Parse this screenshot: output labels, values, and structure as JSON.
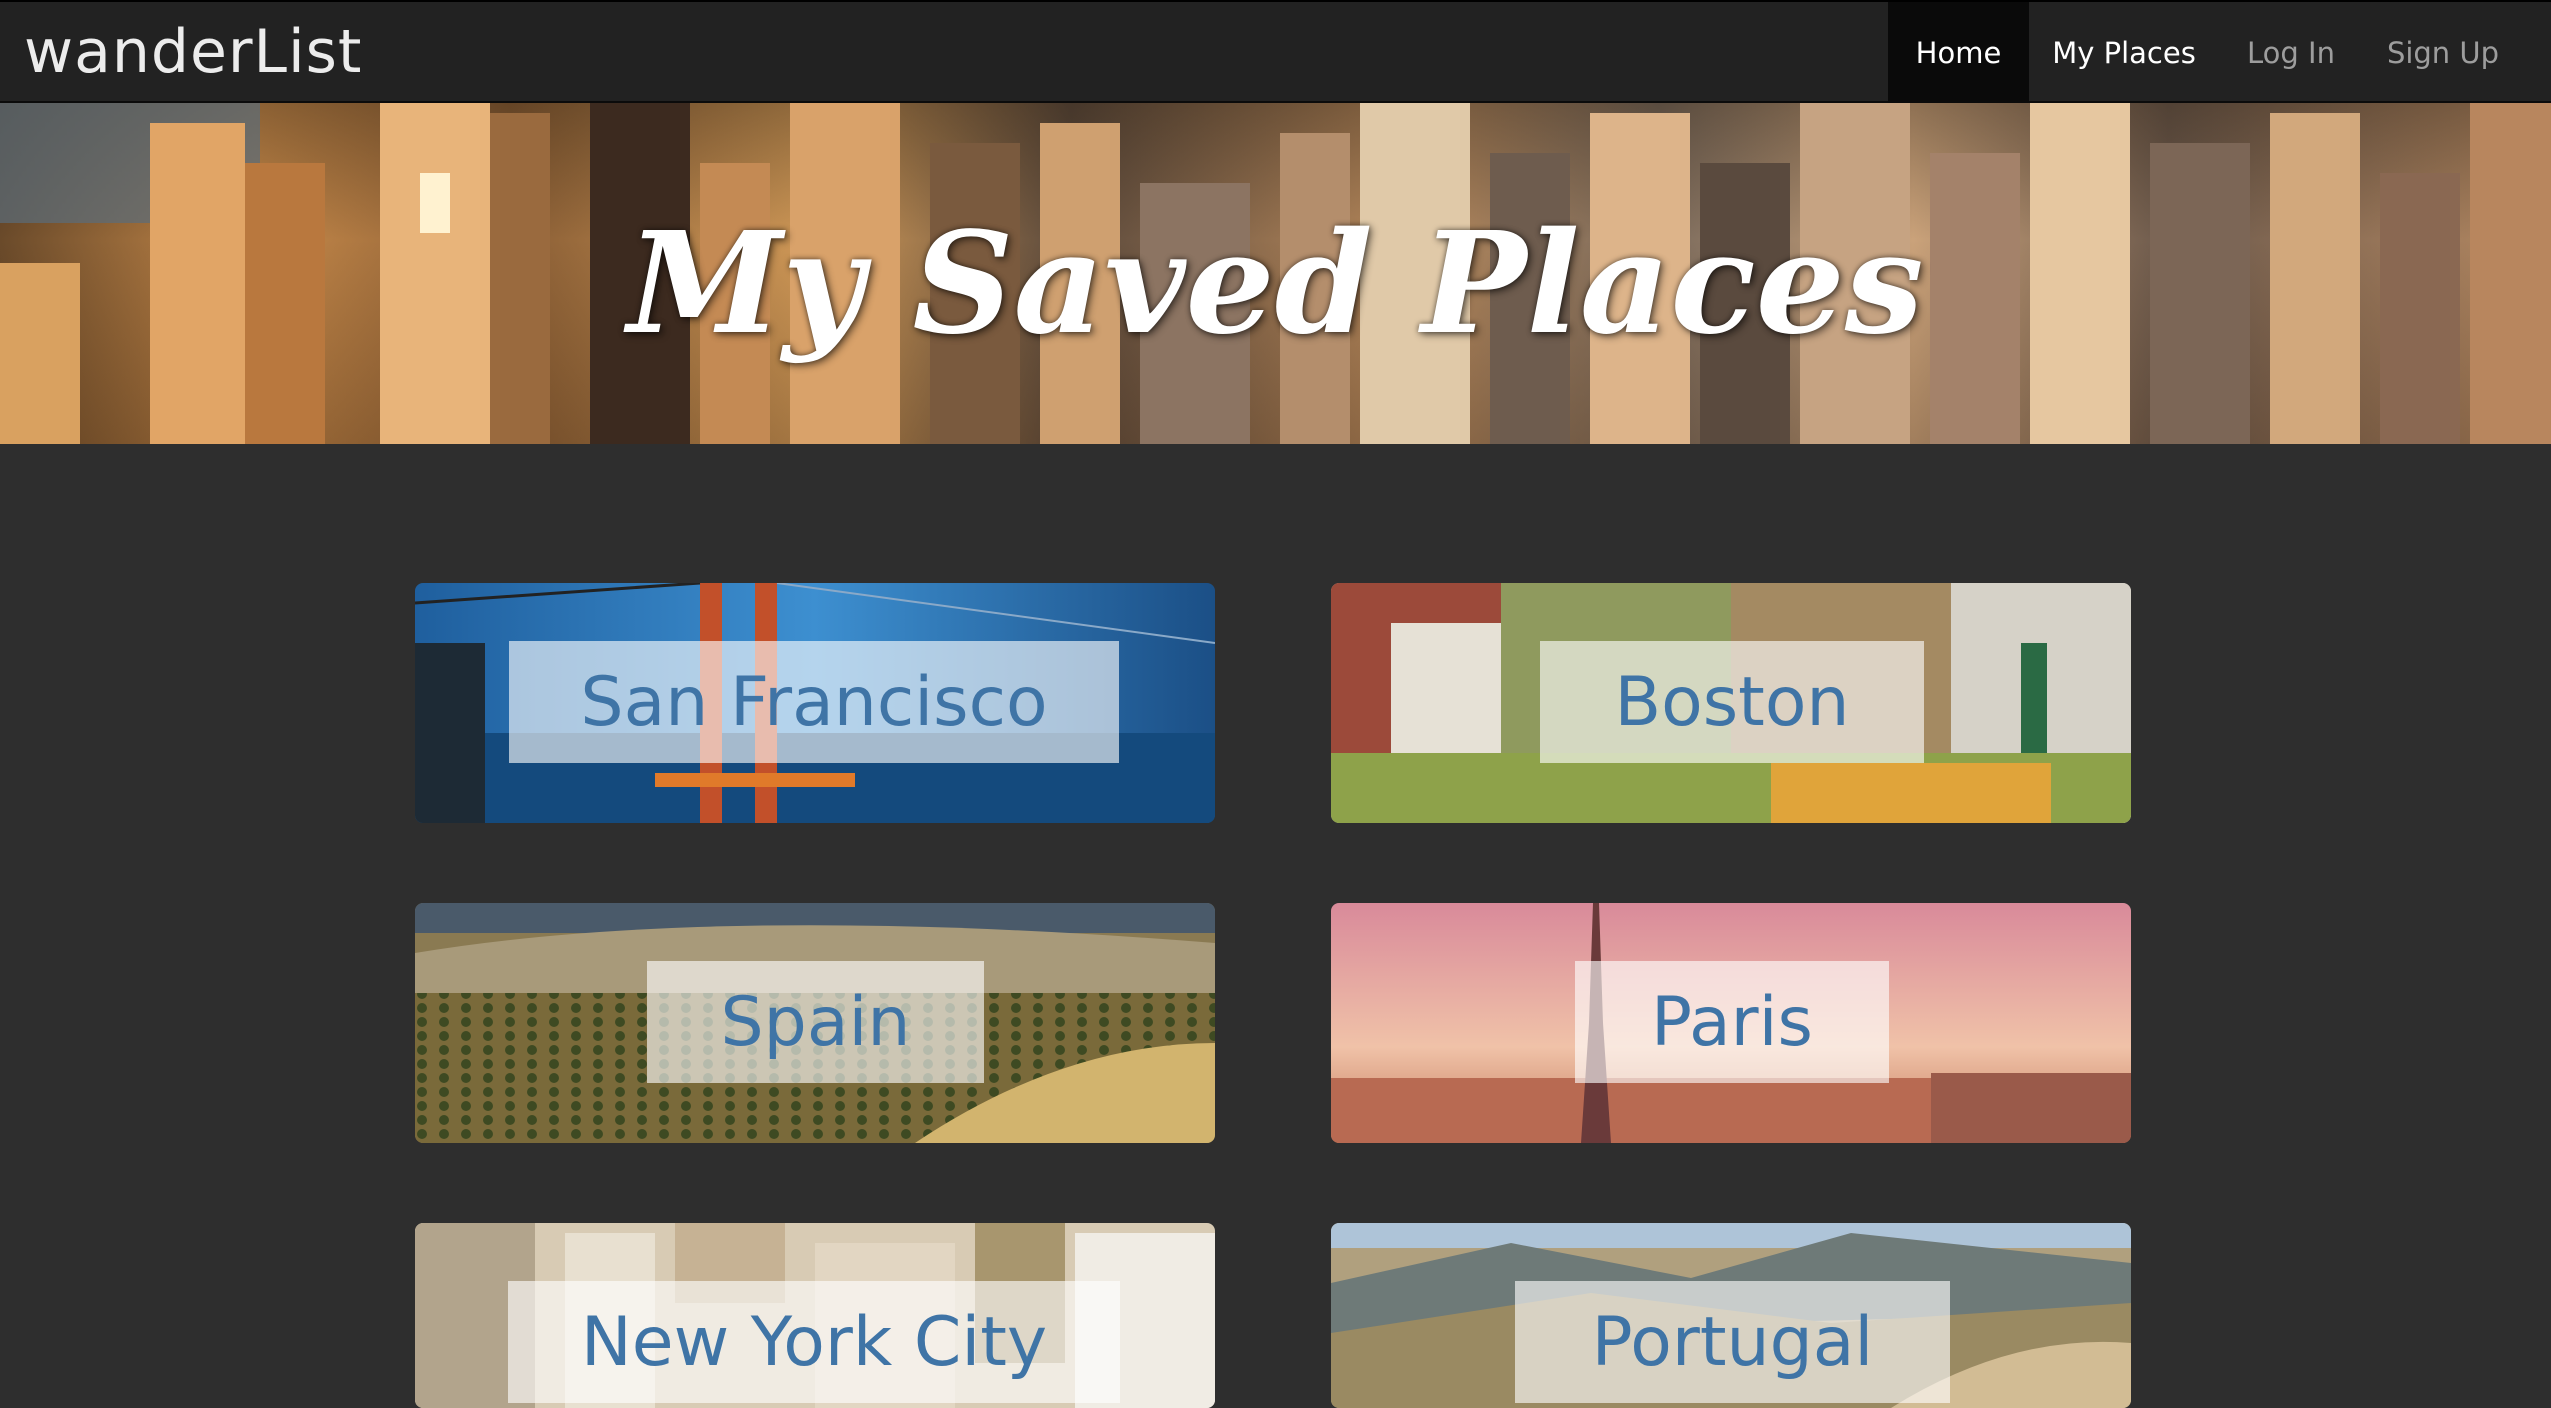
{
  "navbar": {
    "brand": "wanderList",
    "items": [
      {
        "label": "Home"
      },
      {
        "label": "My Places"
      },
      {
        "label": "Log In"
      },
      {
        "label": "Sign Up"
      }
    ]
  },
  "hero": {
    "title": "My Saved Places"
  },
  "places": [
    {
      "name": "San Francisco"
    },
    {
      "name": "Boston"
    },
    {
      "name": "Spain"
    },
    {
      "name": "Paris"
    },
    {
      "name": "New York City"
    },
    {
      "name": "Portugal"
    }
  ],
  "colors": {
    "background": "#2e2e2e",
    "navbar": "#222222",
    "nav_active": "#0a0a0a",
    "card_label_text": "#3f74a6"
  }
}
